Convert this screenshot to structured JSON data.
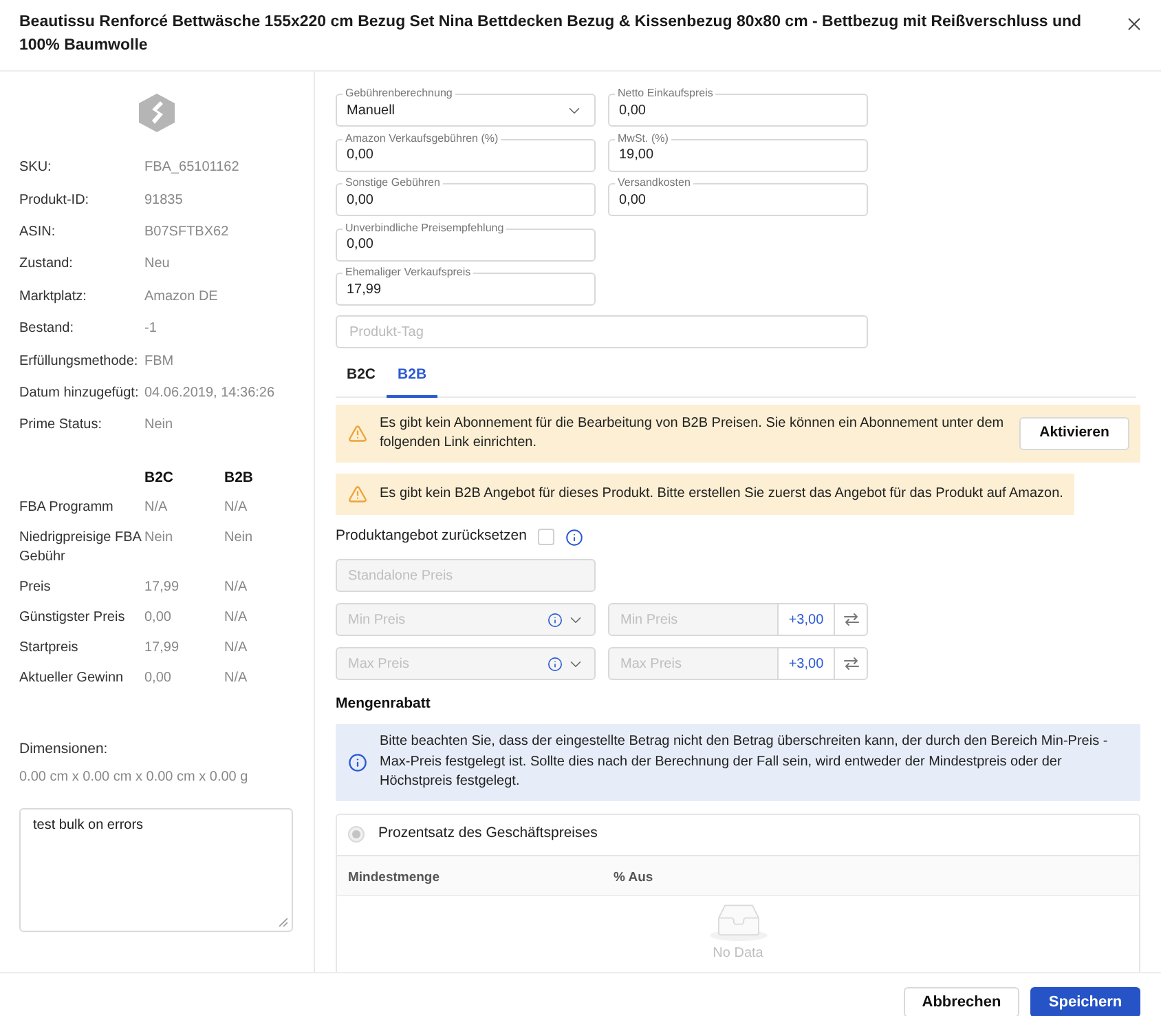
{
  "dialog": {
    "title": "Beautissu Renforcé Bettwäsche 155x220 cm Bezug Set Nina Bettdecken Bezug & Kissenbezug 80x80 cm - Bettbezug mit Reißverschluss und 100% Baumwolle"
  },
  "product_info": [
    {
      "label": "SKU:",
      "value": "FBA_65101162"
    },
    {
      "label": "Produkt-ID:",
      "value": "91835"
    },
    {
      "label": "ASIN:",
      "value": "B07SFTBX62"
    },
    {
      "label": "Zustand:",
      "value": "Neu"
    },
    {
      "label": "Marktplatz:",
      "value": "Amazon DE"
    },
    {
      "label": "Bestand:",
      "value": "-1"
    },
    {
      "label": "Erfüllungsmethode:",
      "value": "FBM"
    },
    {
      "label": "Datum hinzugefügt:",
      "value": "04.06.2019, 14:36:26"
    },
    {
      "label": "Prime Status:",
      "value": "Nein"
    }
  ],
  "channel_table": {
    "columns": [
      "B2C",
      "B2B"
    ],
    "rows": [
      {
        "label": "FBA Programm",
        "values": [
          "N/A",
          "N/A"
        ]
      },
      {
        "label": "Niedrigpreisige FBA Gebühr",
        "values": [
          "Nein",
          "Nein"
        ]
      },
      {
        "label": "Preis",
        "values": [
          "17,99",
          "N/A"
        ]
      },
      {
        "label": "Günstigster Preis",
        "values": [
          "0,00",
          "N/A"
        ]
      },
      {
        "label": "Startpreis",
        "values": [
          "17,99",
          "N/A"
        ]
      },
      {
        "label": "Aktueller Gewinn",
        "values": [
          "0,00",
          "N/A"
        ]
      }
    ]
  },
  "dimensions": {
    "label": "Dimensionen:",
    "value": "0.00 cm x 0.00 cm x 0.00 cm x 0.00 g"
  },
  "note": {
    "value": "test bulk on errors"
  },
  "fee_columns": [
    [
      {
        "kind": "select",
        "label": "Gebührenberechnung",
        "value": "Manuell"
      },
      {
        "kind": "input",
        "label": "Amazon Verkaufsgebühren (%)",
        "value": "0,00"
      },
      {
        "kind": "input",
        "label": "Sonstige Gebühren",
        "value": "0,00"
      },
      {
        "kind": "input",
        "label": "Unverbindliche Preisempfehlung",
        "value": "0,00"
      },
      {
        "kind": "input",
        "label": "Ehemaliger Verkaufspreis",
        "value": "17,99"
      }
    ],
    [
      {
        "kind": "input",
        "label": "Netto Einkaufspreis",
        "value": "0,00"
      },
      {
        "kind": "input",
        "label": "MwSt. (%)",
        "value": "19,00"
      },
      {
        "kind": "input",
        "label": "Versandkosten",
        "value": "0,00"
      }
    ]
  ],
  "product_tag": {
    "placeholder": "Produkt-Tag"
  },
  "tabs": [
    {
      "label": "B2C",
      "selected": false
    },
    {
      "label": "B2B",
      "selected": true
    }
  ],
  "alerts": [
    {
      "kind": "warning",
      "text": "Es gibt kein Abonnement für die Bearbeitung von B2B Preisen. Sie können ein Abonnement unter dem folgenden Link einrichten.",
      "button": "Aktivieren"
    },
    {
      "kind": "warning",
      "text": "Es gibt kein B2B Angebot für dieses Produkt. Bitte erstellen Sie zuerst das Angebot für das Produkt auf Amazon."
    }
  ],
  "reset_offer": {
    "label": "Produktangebot zurücksetzen",
    "checked": false
  },
  "standalone_price": {
    "placeholder": "Standalone Preis",
    "disabled": true
  },
  "price_limits": [
    {
      "select_placeholder": "Min Preis",
      "input_placeholder": "Min Preis",
      "addon": "+3,00",
      "disabled": true
    },
    {
      "select_placeholder": "Max Preis",
      "input_placeholder": "Max Preis",
      "addon": "+3,00",
      "disabled": true
    }
  ],
  "quantity_discount": {
    "title": "Mengenrabatt",
    "info": "Bitte beachten Sie, dass der eingestellte Betrag nicht den Betrag überschreiten kann, der durch den Bereich Min-Preis - Max-Preis festgelegt ist. Sollte dies nach der Berechnung der Fall sein, wird entweder der Mindestpreis oder der Höchstpreis festgelegt.",
    "option": {
      "label": "Prozentsatz des Geschäftspreises",
      "selected": true,
      "disabled": true
    },
    "columns": [
      "Mindestmenge",
      "% Aus"
    ],
    "empty_text": "No Data"
  },
  "footer": {
    "buttons": [
      {
        "label": "Abbrechen",
        "kind": "secondary"
      },
      {
        "label": "Speichern",
        "kind": "primary"
      }
    ]
  }
}
